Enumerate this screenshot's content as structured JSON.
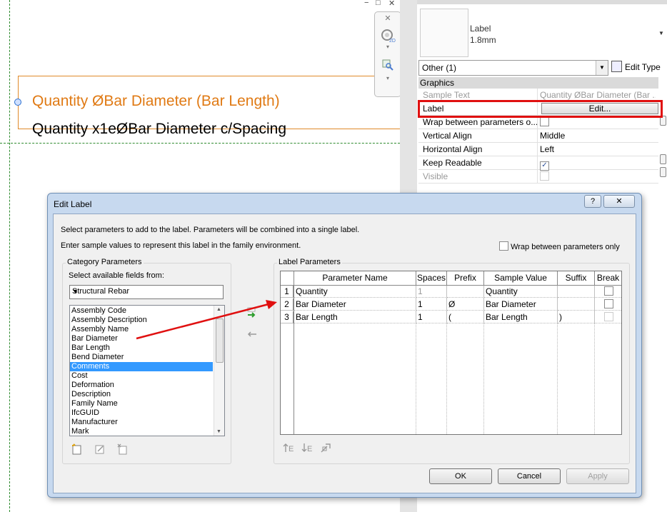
{
  "canvas": {
    "label_line_1": "Quantity ØBar Diameter (Bar Length)",
    "label_line_2": "Quantity x1eØBar Diameter c/Spacing"
  },
  "window_controls": [
    "−",
    "□",
    "✕"
  ],
  "properties": {
    "type_name_line1": "Label",
    "type_name_line2": "1.8mm",
    "selector": "Other (1)",
    "edit_type": "Edit Type",
    "group": "Graphics",
    "rows": [
      {
        "key": "Sample Text",
        "value": "Quantity ØBar Diameter (Bar ...",
        "disabled": true
      },
      {
        "key": "Label",
        "value": "Edit...",
        "button": true
      },
      {
        "key": "Wrap between parameters o...",
        "checkbox": false
      },
      {
        "key": "Vertical Align",
        "value": "Middle"
      },
      {
        "key": "Horizontal Align",
        "value": "Left"
      },
      {
        "key": "Keep Readable",
        "checkbox": true
      },
      {
        "key": "Visible",
        "checkbox": false,
        "disabled": true
      }
    ]
  },
  "dialog": {
    "title": "Edit Label",
    "help": "?",
    "close": "✕",
    "instruction_1": "Select parameters to add to the label.  Parameters will be combined into a single label.",
    "instruction_2": "Enter sample values to represent this label in the family environment.",
    "wrap_checkbox_label": "Wrap between parameters only",
    "category_group_title": "Category Parameters",
    "select_fields_label": "Select available fields from:",
    "category_value": "Structural Rebar",
    "available_fields": [
      "Assembly Code",
      "Assembly Description",
      "Assembly Name",
      "Bar Diameter",
      "Bar Length",
      "Bend Diameter",
      "Comments",
      "Cost",
      "Deformation",
      "Description",
      "Family Name",
      "IfcGUID",
      "Manufacturer",
      "Mark"
    ],
    "selected_field": "Comments",
    "label_group_title": "Label Parameters",
    "columns": [
      "Parameter Name",
      "Spaces",
      "Prefix",
      "Sample Value",
      "Suffix",
      "Break"
    ],
    "rows": [
      {
        "num": "1",
        "name": "Quantity",
        "spaces": "1",
        "prefix": "",
        "sample": "Quantity",
        "suffix": "",
        "break": false
      },
      {
        "num": "2",
        "name": "Bar Diameter",
        "spaces": "1",
        "prefix": "Ø",
        "sample": "Bar Diameter",
        "suffix": "",
        "break": false
      },
      {
        "num": "3",
        "name": "Bar Length",
        "spaces": "1",
        "prefix": "(",
        "sample": "Bar Length",
        "suffix": ")",
        "break": false
      }
    ],
    "ok": "OK",
    "cancel": "Cancel",
    "apply": "Apply"
  },
  "colors": {
    "label_orange": "#e07a14",
    "highlight_red": "#e01010",
    "selection_blue": "#3399ff",
    "guide_green": "#2e8b2e"
  }
}
